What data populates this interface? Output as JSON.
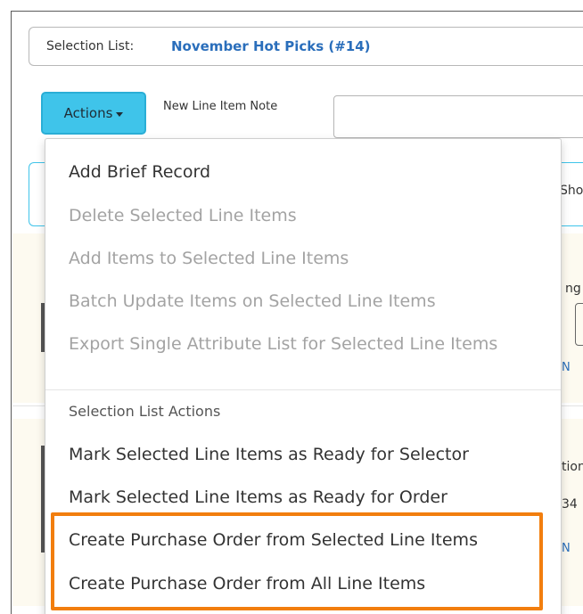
{
  "selection_list": {
    "label": "Selection List:",
    "value": "November Hot Picks (#14)"
  },
  "toolbar": {
    "actions_label": "Actions",
    "note_label": "New Line Item Note",
    "note_value": ""
  },
  "background": {
    "tab_fragment": "Sho",
    "field_fragment_1": "ng",
    "link_fragment_1": "N",
    "field_fragment_2": "tion",
    "value_fragment": "34",
    "link_fragment_2": "N"
  },
  "menu": {
    "items": [
      {
        "label": "Add Brief Record",
        "enabled": true
      },
      {
        "label": "Delete Selected Line Items",
        "enabled": false
      },
      {
        "label": "Add Items to Selected Line Items",
        "enabled": false
      },
      {
        "label": "Batch Update Items on Selected Line Items",
        "enabled": false
      },
      {
        "label": "Export Single Attribute List for Selected Line Items",
        "enabled": false
      }
    ],
    "section_header": "Selection List Actions",
    "section_items": [
      {
        "label": "Mark Selected Line Items as Ready for Selector",
        "enabled": true
      },
      {
        "label": "Mark Selected Line Items as Ready for Order",
        "enabled": true
      },
      {
        "label": "Create Purchase Order from Selected Line Items",
        "enabled": true
      },
      {
        "label": "Create Purchase Order from All Line Items",
        "enabled": true
      }
    ]
  },
  "colors": {
    "actions_button": "#3fc4ea",
    "link_blue": "#2a6ebb",
    "highlight_orange": "#f27e0e",
    "disabled_text": "#a3a3a3"
  }
}
